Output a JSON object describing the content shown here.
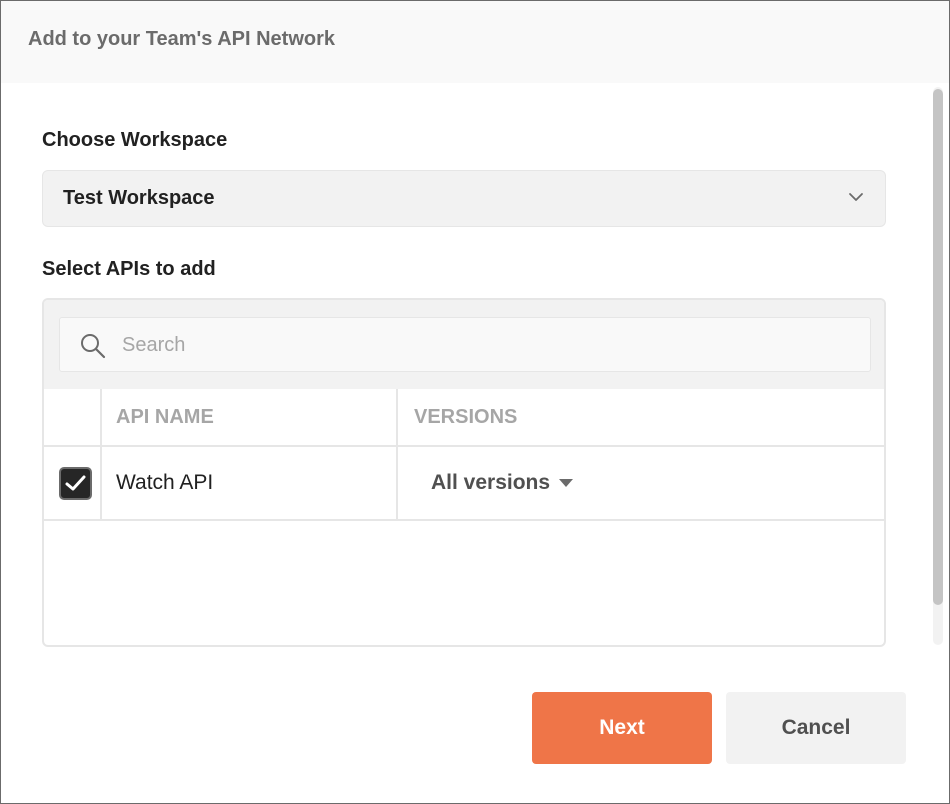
{
  "dialog": {
    "title": "Add to your Team's API Network"
  },
  "workspace": {
    "label": "Choose Workspace",
    "selected": "Test Workspace",
    "icon": "chevron-down-icon"
  },
  "apis": {
    "label": "Select APIs to add",
    "search": {
      "placeholder": "Search",
      "value": "",
      "icon": "search-icon"
    },
    "columns": [
      "API NAME",
      "VERSIONS"
    ],
    "rows": [
      {
        "checked": true,
        "name": "Watch API",
        "versions": "All versions"
      }
    ]
  },
  "actions": {
    "next_label": "Next",
    "cancel_label": "Cancel"
  },
  "colors": {
    "accent": "#ef7548",
    "checkbox_fill": "#262626",
    "panel_bg": "#f2f2f2"
  }
}
